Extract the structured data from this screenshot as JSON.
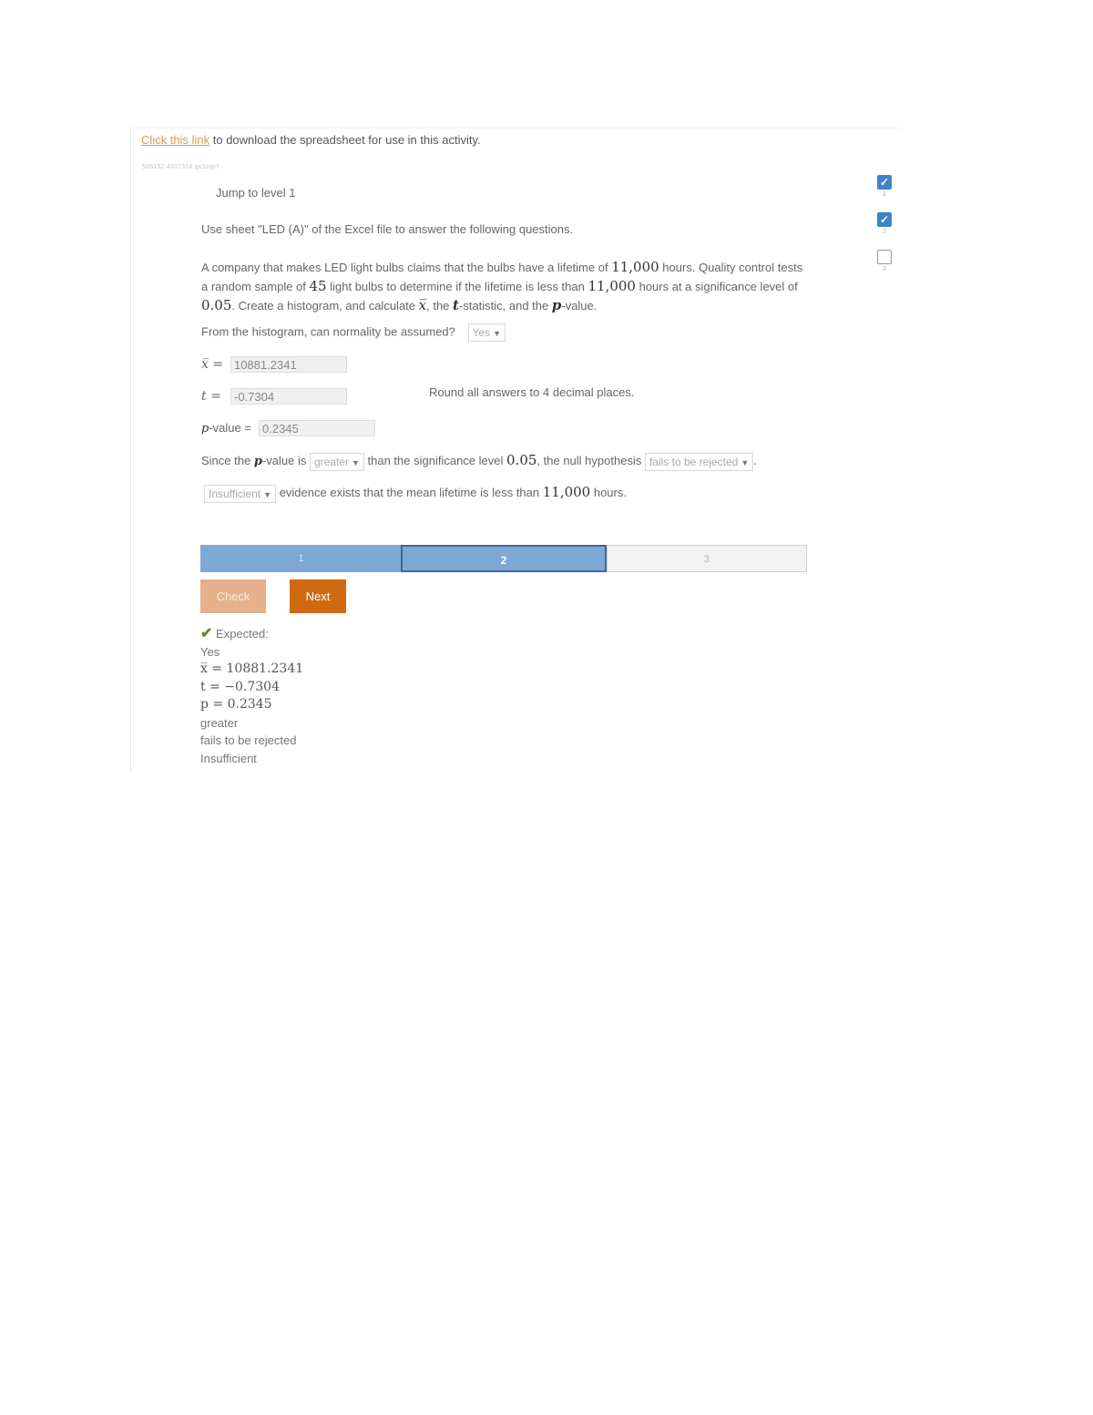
{
  "header": {
    "link_text": "Click this link",
    "link_rest": " to download the spreadsheet for use in this activity.",
    "activity_id": "586152.4307314.qx3zqy7"
  },
  "jump_label": "Jump to level 1",
  "instruction": "Use sheet \"LED (A)\" of the Excel file to answer the following questions.",
  "problem": {
    "p1": "A company that makes LED light bulbs claims that the bulbs have a lifetime of ",
    "n1": "11,000",
    "p2": " hours. Quality control tests a random sample of ",
    "n2": "45",
    "p3": " light bulbs to determine if the lifetime is less than ",
    "n3": "11,000",
    "p4": " hours at a significance level of ",
    "n4": "0.05",
    "p5": ". Create a histogram, and calculate ",
    "xbar": "x̅",
    "p6": ", the ",
    "t": "t",
    "p7": "-statistic, and the ",
    "p": "p",
    "p8": "-value."
  },
  "normality": {
    "question": "From the histogram, can normality be assumed?",
    "selected": "Yes"
  },
  "fields": {
    "xbar_label": "x̅ =",
    "xbar_value": "10881.2341",
    "t_label": "t =",
    "t_value": "-0.7304",
    "p_label_italic": "p",
    "p_label_rest": "-value =",
    "p_value": "0.2345",
    "round_note": "Round all answers to 4 decimal places."
  },
  "conclusion": {
    "s1": "Since the ",
    "p": "p",
    "s2": "-value is ",
    "sel1": "greater",
    "s3": " than the significance level ",
    "n": "0.05",
    "s4": ", the null hypothesis ",
    "sel2": "fails to be rejected",
    "s5": "."
  },
  "evidence": {
    "sel": "Insufficient",
    "s1": " evidence exists that the mean lifetime is less than ",
    "n": "11,000",
    "s2": " hours."
  },
  "progress": {
    "seg1": "1",
    "seg2": "2",
    "seg3": "3"
  },
  "buttons": {
    "check": "Check",
    "next": "Next"
  },
  "expected": {
    "label": "Expected:",
    "a1": "Yes",
    "a2": "x̅ = 10881.2341",
    "a3": "t = −0.7304",
    "a4": "p = 0.2345",
    "a5": "greater",
    "a6": "fails to be rejected",
    "a7": "Insufficient"
  },
  "levels": [
    {
      "num": "1",
      "checked": true
    },
    {
      "num": "2",
      "checked": true
    },
    {
      "num": "3",
      "checked": false
    }
  ],
  "colors": {
    "link": "#d79a52",
    "next_button": "#cf6a12",
    "check_button": "#e5b08a",
    "progress_fill": "#7ea8d6",
    "checkbox_on": "#3c83c9",
    "check_mark": "#5e8a3a"
  },
  "icons": [
    "checkbox-checked-icon",
    "checkbox-unchecked-icon",
    "chevron-down-icon",
    "checkmark-icon"
  ]
}
